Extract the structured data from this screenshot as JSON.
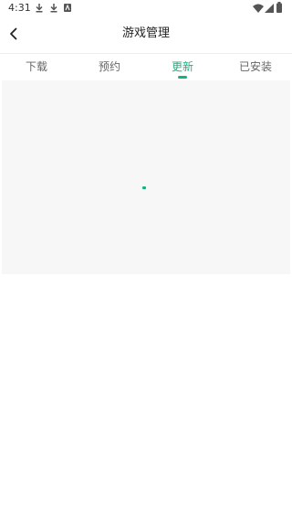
{
  "status_bar": {
    "time": "4:31",
    "icons": [
      "download-icon",
      "download-icon",
      "app-notification-icon",
      "wifi-icon",
      "signal-icon",
      "battery-icon"
    ]
  },
  "header": {
    "back_icon": "chevron-left-icon",
    "title": "游戏管理"
  },
  "tabs": [
    {
      "label": "下载",
      "active": false
    },
    {
      "label": "预约",
      "active": false
    },
    {
      "label": "更新",
      "active": true
    },
    {
      "label": "已安装",
      "active": false
    }
  ],
  "content": {
    "state": "loading"
  },
  "colors": {
    "accent": "#14b57b",
    "tab_inactive": "#666666",
    "content_bg": "#f7f7f7"
  }
}
